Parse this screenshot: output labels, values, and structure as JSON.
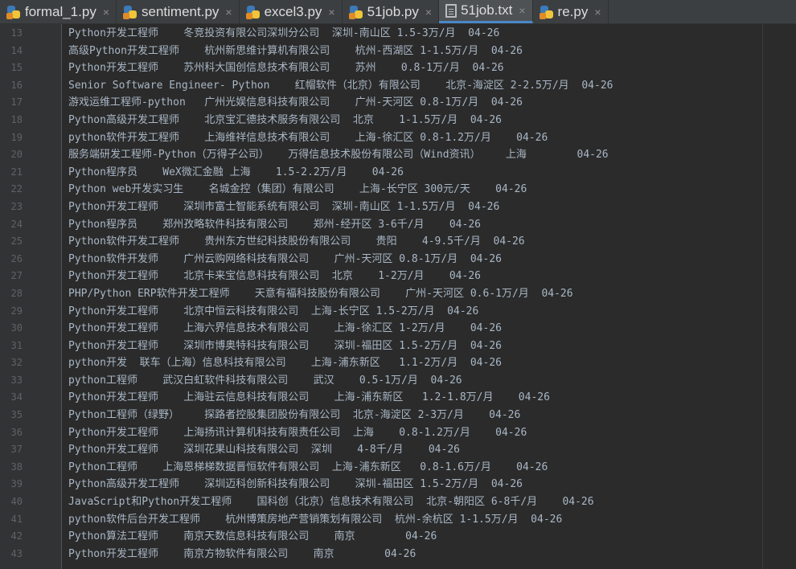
{
  "tabs": [
    {
      "name": "formal_1.py",
      "icon": "python-file-icon",
      "active": false
    },
    {
      "name": "sentiment.py",
      "icon": "python-file-icon",
      "active": false
    },
    {
      "name": "excel3.py",
      "icon": "python-file-icon",
      "active": false
    },
    {
      "name": "51job.py",
      "icon": "python-file-icon",
      "active": false
    },
    {
      "name": "51job.txt",
      "icon": "text-file-icon",
      "active": true
    },
    {
      "name": "re.py",
      "icon": "python-file-icon",
      "active": false
    }
  ],
  "close_glyph": "×",
  "lines": [
    {
      "n": "13",
      "text": "Python开发工程师    冬竞投资有限公司深圳分公司  深圳-南山区 1.5-3万/月  04-26"
    },
    {
      "n": "14",
      "text": "高级Python开发工程师    杭州新思维计算机有限公司    杭州-西湖区 1-1.5万/月  04-26"
    },
    {
      "n": "15",
      "text": "Python开发工程师    苏州科大国创信息技术有限公司    苏州    0.8-1万/月  04-26"
    },
    {
      "n": "16",
      "text": "Senior Software Engineer- Python    红帽软件（北京）有限公司    北京-海淀区 2-2.5万/月  04-26"
    },
    {
      "n": "17",
      "text": "游戏运维工程师-python   广州光娱信息科技有限公司    广州-天河区 0.8-1万/月  04-26"
    },
    {
      "n": "18",
      "text": "Python高级开发工程师    北京宝汇德技术服务有限公司  北京    1-1.5万/月  04-26"
    },
    {
      "n": "19",
      "text": "python软件开发工程师    上海维祥信息技术有限公司    上海-徐汇区 0.8-1.2万/月    04-26"
    },
    {
      "n": "20",
      "text": "服务端研发工程师-Python（万得子公司）   万得信息技术股份有限公司（Wind资讯）    上海        04-26"
    },
    {
      "n": "21",
      "text": "Python程序员    WeX微汇金融 上海    1.5-2.2万/月    04-26"
    },
    {
      "n": "22",
      "text": "Python web开发实习生    名城金控（集团）有限公司    上海-长宁区 300元/天    04-26"
    },
    {
      "n": "23",
      "text": "Python开发工程师    深圳市富士智能系统有限公司  深圳-南山区 1-1.5万/月  04-26"
    },
    {
      "n": "24",
      "text": "Python程序员    郑州孜略软件科技有限公司    郑州-经开区 3-6千/月    04-26"
    },
    {
      "n": "25",
      "text": "Python软件开发工程师    贵州东方世纪科技股份有限公司    贵阳    4-9.5千/月  04-26"
    },
    {
      "n": "26",
      "text": "Python软件开发师    广州云购网络科技有限公司    广州-天河区 0.8-1万/月  04-26"
    },
    {
      "n": "27",
      "text": "Python开发工程师    北京卡来宝信息科技有限公司  北京    1-2万/月    04-26"
    },
    {
      "n": "28",
      "text": "PHP/Python ERP软件开发工程师    天意有福科技股份有限公司    广州-天河区 0.6-1万/月  04-26"
    },
    {
      "n": "29",
      "text": "Python开发工程师    北京中恒云科技有限公司  上海-长宁区 1.5-2万/月  04-26"
    },
    {
      "n": "30",
      "text": "Python开发工程师    上海六界信息技术有限公司    上海-徐汇区 1-2万/月    04-26"
    },
    {
      "n": "31",
      "text": "Python开发工程师    深圳市博奥特科技有限公司    深圳-福田区 1.5-2万/月  04-26"
    },
    {
      "n": "32",
      "text": "python开发  联车（上海）信息科技有限公司    上海-浦东新区   1.1-2万/月  04-26"
    },
    {
      "n": "33",
      "text": "python工程师    武汉白虹软件科技有限公司    武汉    0.5-1万/月  04-26"
    },
    {
      "n": "34",
      "text": "Python开发工程师    上海驻云信息科技有限公司    上海-浦东新区   1.2-1.8万/月    04-26"
    },
    {
      "n": "35",
      "text": "Python工程师（绿野）    探路者控股集团股份有限公司  北京-海淀区 2-3万/月    04-26"
    },
    {
      "n": "36",
      "text": "Python开发工程师    上海扬讯计算机科技有限责任公司  上海    0.8-1.2万/月    04-26"
    },
    {
      "n": "37",
      "text": "Python开发工程师    深圳花果山科技有限公司  深圳    4-8千/月    04-26"
    },
    {
      "n": "38",
      "text": "Python工程师    上海恩梯梯数据晋恒软件有限公司  上海-浦东新区   0.8-1.6万/月    04-26"
    },
    {
      "n": "39",
      "text": "Python高级开发工程师    深圳迈科创新科技有限公司    深圳-福田区 1.5-2万/月  04-26"
    },
    {
      "n": "40",
      "text": "JavaScript和Python开发工程师    国科创（北京）信息技术有限公司  北京-朝阳区 6-8千/月    04-26"
    },
    {
      "n": "41",
      "text": "python软件后台开发工程师    杭州博策房地产营销策划有限公司  杭州-余杭区 1-1.5万/月  04-26"
    },
    {
      "n": "42",
      "text": "Python算法工程师    南京天数信息科技有限公司    南京        04-26"
    },
    {
      "n": "43",
      "text": "Python开发工程师    南京方物软件有限公司    南京        04-26"
    }
  ]
}
